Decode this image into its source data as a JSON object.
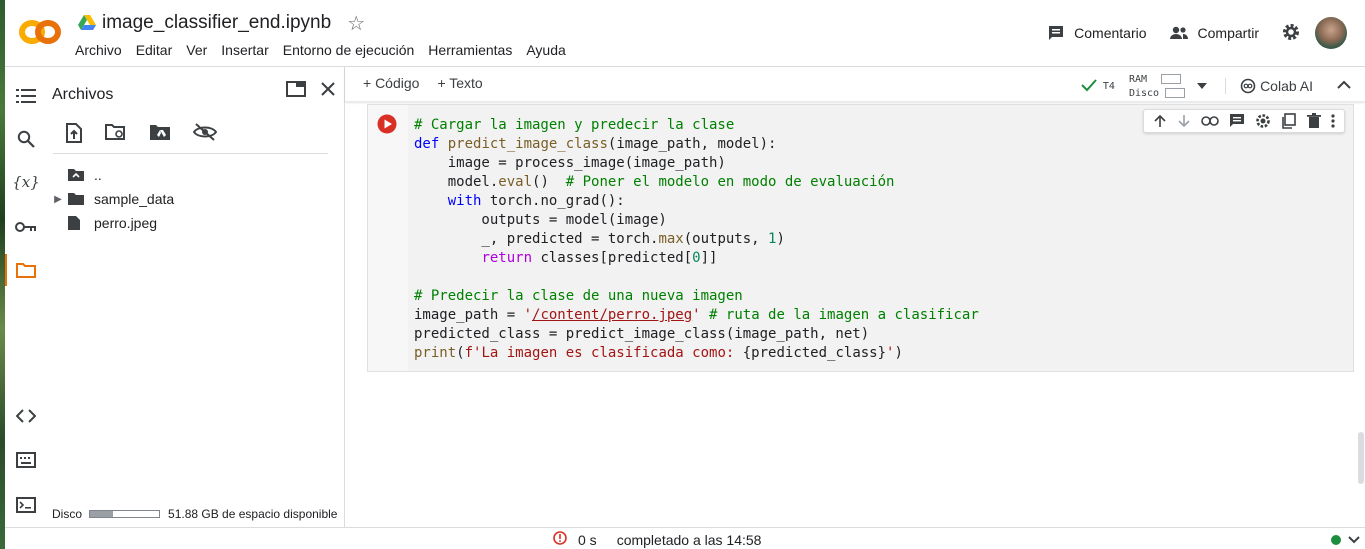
{
  "app": {
    "notebook_title": "image_classifier_end.ipynb",
    "logo_text": "CO",
    "menu": [
      "Archivo",
      "Editar",
      "Ver",
      "Insertar",
      "Entorno de ejecución",
      "Herramientas",
      "Ayuda"
    ],
    "comment_label": "Comentario",
    "share_label": "Compartir",
    "accent_color": "#f9ab00"
  },
  "files_panel": {
    "title": "Archivos",
    "items": [
      {
        "label": "..",
        "icon": "folder-up-icon"
      },
      {
        "label": "sample_data",
        "icon": "folder-icon"
      },
      {
        "label": "perro.jpeg",
        "icon": "file-icon"
      }
    ],
    "disk_label": "Disco",
    "disk_free": "51.88 GB de espacio disponible",
    "disk_used_fraction": 0.33
  },
  "toolbar": {
    "add_code": "+ Código",
    "add_text": "+ Texto",
    "runtime": "T4",
    "ram_label": "RAM",
    "disk_label": "Disco",
    "colab_ai": "Colab AI"
  },
  "cell": {
    "lines": [
      "# Cargar la imagen y predecir la clase",
      "def predict_image_class(image_path, model):",
      "    image = process_image(image_path)",
      "    model.eval()  # Poner el modelo en modo de evaluación",
      "    with torch.no_grad():",
      "        outputs = model(image)",
      "        _, predicted = torch.max(outputs, 1)",
      "        return classes[predicted[0]]",
      "",
      "# Predecir la clase de una nueva imagen",
      "image_path = '/content/perro.jpeg' # ruta de la imagen a clasificar",
      "predicted_class = predict_image_class(image_path, net)",
      "print(f'La imagen es clasificada como: {predicted_class}')"
    ]
  },
  "status": {
    "duration": "0 s",
    "completed": "completado a las 14:58"
  }
}
